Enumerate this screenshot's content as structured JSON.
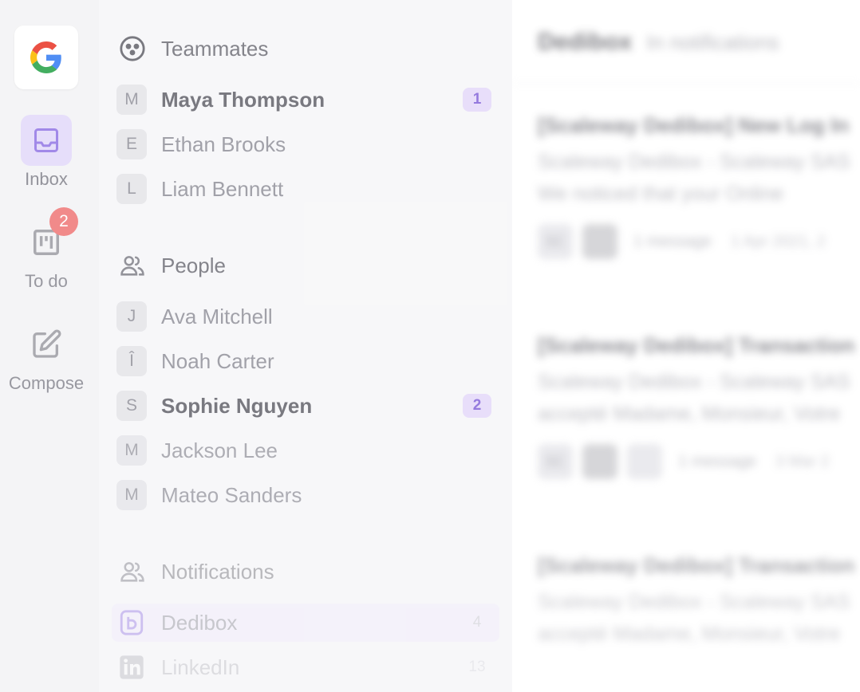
{
  "rail": {
    "brand_icon": "google-g-icon",
    "items": [
      {
        "label": "Inbox",
        "icon": "inbox-tray-icon",
        "active": true
      },
      {
        "label": "To do",
        "icon": "kanban-board-icon",
        "badge": "2"
      },
      {
        "label": "Compose",
        "icon": "pencil-square-icon"
      }
    ]
  },
  "teammates": {
    "title": "Teammates",
    "icon": "teammates-circle-icon",
    "items": [
      {
        "initial": "M",
        "name": "Maya Thompson",
        "count": "1"
      },
      {
        "initial": "E",
        "name": "Ethan Brooks"
      },
      {
        "initial": "L",
        "name": "Liam Bennett"
      }
    ]
  },
  "people": {
    "title": "People",
    "icon": "people-icon",
    "items": [
      {
        "initial": "J",
        "name": "Ava Mitchell"
      },
      {
        "initial": "Î",
        "name": "Noah Carter"
      },
      {
        "initial": "S",
        "name": "Sophie Nguyen",
        "count": "2"
      },
      {
        "initial": "M",
        "name": "Jackson Lee"
      },
      {
        "initial": "M",
        "name": "Mateo Sanders"
      }
    ]
  },
  "notifications": {
    "title": "Notifications",
    "icon": "people-icon",
    "items": [
      {
        "name": "Dedibox",
        "icon": "dedibox-logo-icon",
        "count": "4"
      },
      {
        "name": "LinkedIn",
        "icon": "linkedin-logo-icon",
        "count": "13"
      }
    ]
  },
  "pane": {
    "title": "Dedibox",
    "subtitle": "In notifications",
    "threads": [
      {
        "subject": "[Scaleway Dedibox] New Log In",
        "line1": "Scaleway Dedibox - Scaleway SAS",
        "line2": "We noticed that your Online",
        "avatar": "SC",
        "count": "1 message",
        "date": "1 Apr 2021, 2"
      },
      {
        "subject": "[Scaleway Dedibox] Transaction",
        "line1": "Scaleway Dedibox - Scaleway SAS",
        "line2": "accepté Madame, Monsieur, Votre",
        "avatar": "SC",
        "count": "1 message",
        "date": "3 Mar 2"
      },
      {
        "subject": "[Scaleway Dedibox] Transaction",
        "line1": "Scaleway Dedibox - Scaleway SAS",
        "line2": "accepté Madame, Monsieur, Votre"
      }
    ]
  },
  "colors": {
    "accent": "#8c6fdc",
    "accent_bg": "#e4dcfa",
    "badge_red": "#f08080"
  }
}
